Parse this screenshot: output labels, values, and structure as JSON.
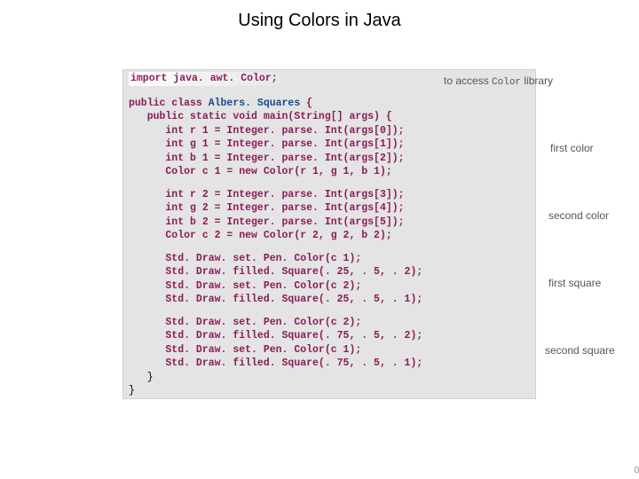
{
  "title": "Using Colors in Java",
  "code": {
    "import_line": "import java. awt. Color;",
    "class_decl_pre": "public class ",
    "class_name": "Albers. Squares",
    "class_decl_post": " {",
    "main_sig": "   public static void main(String[] args) {",
    "color1": [
      "      int r 1 = Integer. parse. Int(args[0]);",
      "      int g 1 = Integer. parse. Int(args[1]);",
      "      int b 1 = Integer. parse. Int(args[2]);",
      "      Color c 1 = new Color(r 1, g 1, b 1);"
    ],
    "color2": [
      "      int r 2 = Integer. parse. Int(args[3]);",
      "      int g 2 = Integer. parse. Int(args[4]);",
      "      int b 2 = Integer. parse. Int(args[5]);",
      "      Color c 2 = new Color(r 2, g 2, b 2);"
    ],
    "square1": [
      "      Std. Draw. set. Pen. Color(c 1);",
      "      Std. Draw. filled. Square(. 25, . 5, . 2);",
      "      Std. Draw. set. Pen. Color(c 2);",
      "      Std. Draw. filled. Square(. 25, . 5, . 1);"
    ],
    "square2": [
      "      Std. Draw. set. Pen. Color(c 2);",
      "      Std. Draw. filled. Square(. 75, . 5, . 2);",
      "      Std. Draw. set. Pen. Color(c 1);",
      "      Std. Draw. filled. Square(. 75, . 5, . 1);"
    ],
    "close_main": "   }",
    "close_class": "}"
  },
  "annotations": {
    "import_pre": "to access ",
    "import_mono": "Color",
    "import_post": " library",
    "first_color": "first color",
    "second_color": "second color",
    "first_square": "first square",
    "second_square": "second square"
  },
  "page_number": "0"
}
